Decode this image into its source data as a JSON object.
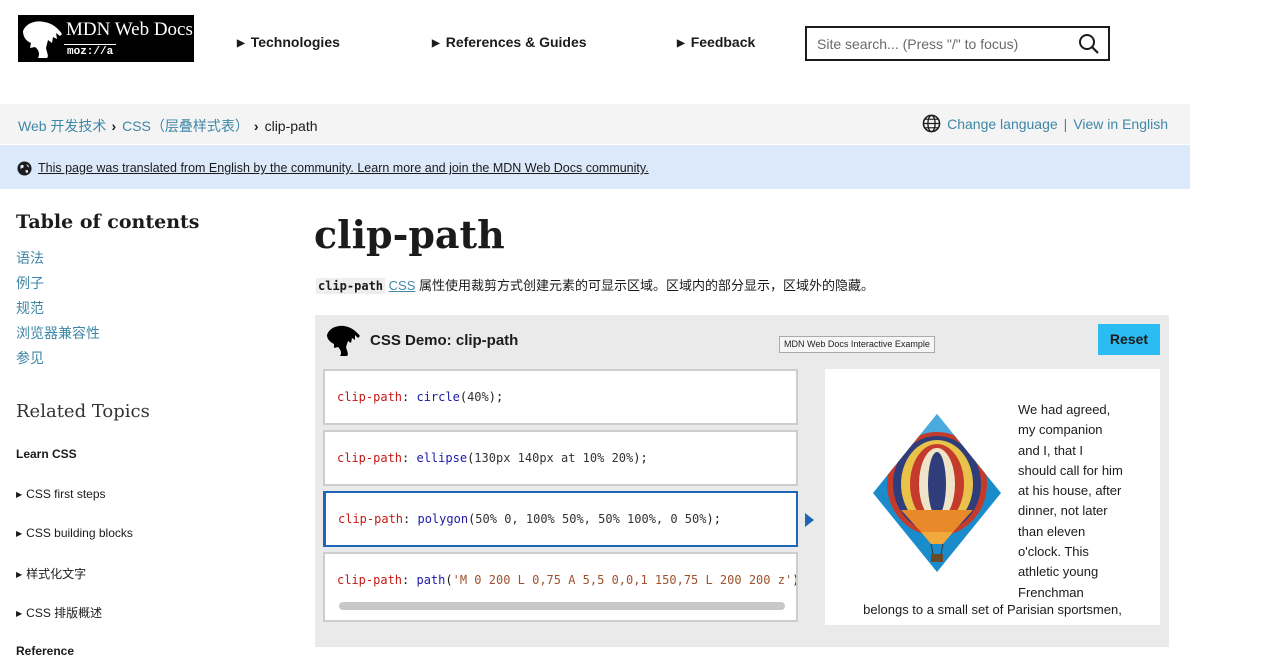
{
  "header": {
    "logo": {
      "title": "MDN Web Docs",
      "sub": "moz://a"
    },
    "nav": [
      {
        "label": "Technologies"
      },
      {
        "label": "References & Guides"
      },
      {
        "label": "Feedback"
      }
    ],
    "search": {
      "placeholder": "Site search... (Press \"/\" to focus)",
      "value": ""
    }
  },
  "breadcrumb": {
    "items": [
      "Web 开发技术",
      "CSS（层叠样式表）",
      "clip-path"
    ],
    "language": {
      "change": "Change language",
      "separator": "|",
      "view_english": "View in English"
    }
  },
  "notice": {
    "text": "This page was translated from English by the community. Learn more and join the MDN Web Docs community."
  },
  "sidebar": {
    "toc_title": "Table of contents",
    "toc": [
      "语法",
      "例子",
      "规范",
      "浏览器兼容性",
      "参见"
    ],
    "related_title": "Related Topics",
    "learn_css": "Learn CSS",
    "learn_items": [
      "CSS first steps",
      "CSS building blocks",
      "样式化文字",
      "CSS 排版概述"
    ],
    "reference": "Reference"
  },
  "main": {
    "title": "clip-path",
    "intro_code": "clip-path",
    "intro_link": "CSS",
    "intro_text": " 属性使用裁剪方式创建元素的可显示区域。区域内的部分显示，区域外的隐藏。"
  },
  "demo": {
    "title": "CSS Demo: clip-path",
    "tooltip": "MDN Web Docs Interactive Example",
    "reset_label": "Reset",
    "choices": [
      {
        "prop": "clip-path",
        "fn": "circle",
        "args": "40%"
      },
      {
        "prop": "clip-path",
        "fn": "ellipse",
        "args": "130px 140px at 10% 20%"
      },
      {
        "prop": "clip-path",
        "fn": "polygon",
        "args": "50% 0, 100% 50%, 50% 100%, 0 50%"
      },
      {
        "prop": "clip-path",
        "fn": "path",
        "args": "'M 0 200 L 0,75 A 5,5 0,0,1 150,75 L 200 200 z'"
      }
    ],
    "selected_index": 2,
    "output_lines": [
      "We had agreed,",
      "my companion",
      "and I, that I",
      "should call for him",
      "at his house, after",
      "dinner, not later",
      "than eleven",
      "o'clock. This",
      "athletic young",
      "Frenchman"
    ],
    "output_last": "belongs to a small set of Parisian sportsmen,",
    "colors": {
      "accent": "#2bbcf3",
      "link": "#3f87a6",
      "selected_border": "#1d67b8",
      "notice_bg": "#dce9fa"
    }
  }
}
